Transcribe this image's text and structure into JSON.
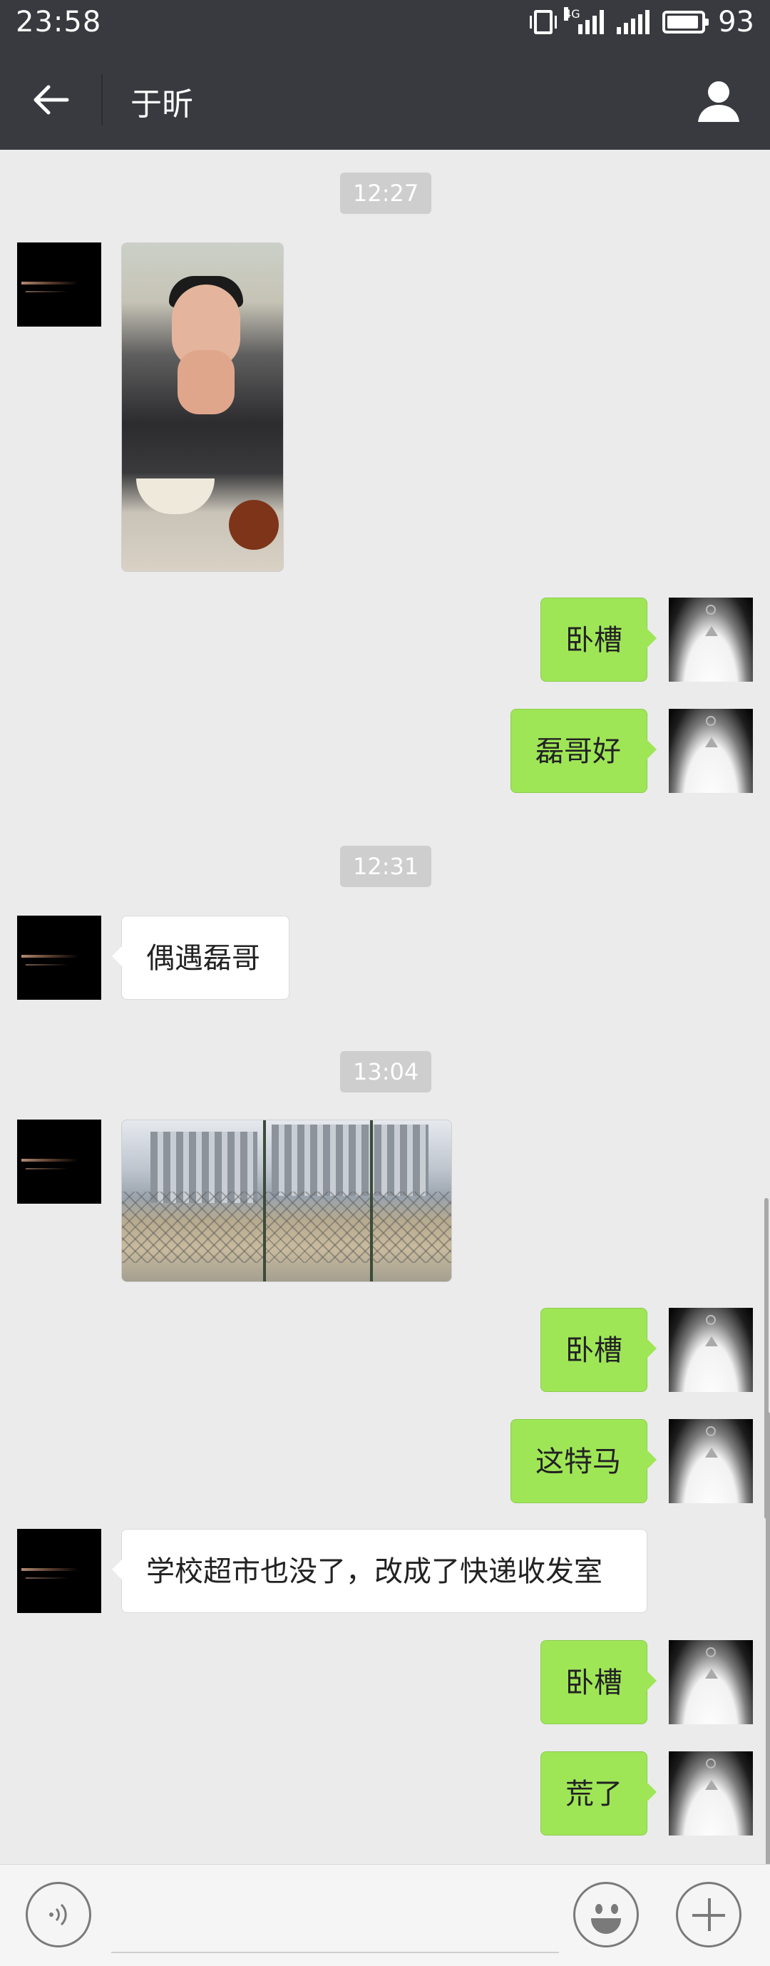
{
  "status_bar": {
    "time": "23:58",
    "network": "4G",
    "battery": "93",
    "battery_level": 0.93
  },
  "header": {
    "title": "于昕"
  },
  "messages": {
    "t1": "12:27",
    "t2": "12:31",
    "t3": "13:04",
    "m2": "卧槽",
    "m3": "磊哥好",
    "m4": "偶遇磊哥",
    "m6": "卧槽",
    "m7": "这特马",
    "m8": "学校超市也没了，改成了快递收发室",
    "m9": "卧槽",
    "m10": "荒了"
  },
  "icons": {
    "back": "arrow-left-icon",
    "profile": "person-icon",
    "voice": "voice-icon",
    "emoji": "smiley-icon",
    "plus": "plus-icon"
  },
  "colors": {
    "topbar": "#393a3f",
    "outgoing_bubble": "#9fe657",
    "incoming_bubble": "#ffffff",
    "background": "#ebebeb"
  }
}
